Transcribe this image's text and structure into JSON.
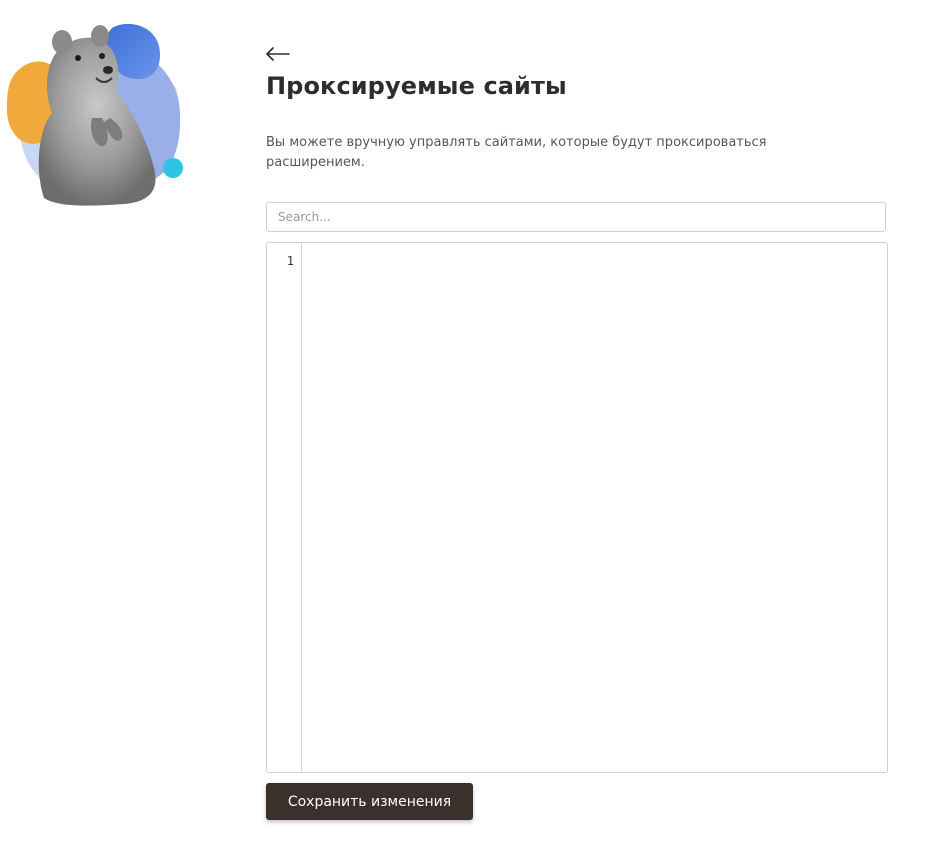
{
  "page": {
    "title": "Проксируемые сайты",
    "description": "Вы можете вручную управлять сайтами, которые будут проксироваться расширением."
  },
  "icons": {
    "back": "arrow-left-icon",
    "mascot": "quokka-illustration"
  },
  "colors": {
    "button_bg": "#3b302b",
    "blob_orange": "#f0a93a",
    "blob_blue": "#4f7fd9",
    "blob_lavender": "#9aaee8",
    "blob_cyan": "#2ec4e6"
  },
  "search": {
    "placeholder": "Search...",
    "value": ""
  },
  "editor": {
    "line_numbers": [
      "1"
    ],
    "content": ""
  },
  "actions": {
    "save_label": "Сохранить изменения"
  }
}
